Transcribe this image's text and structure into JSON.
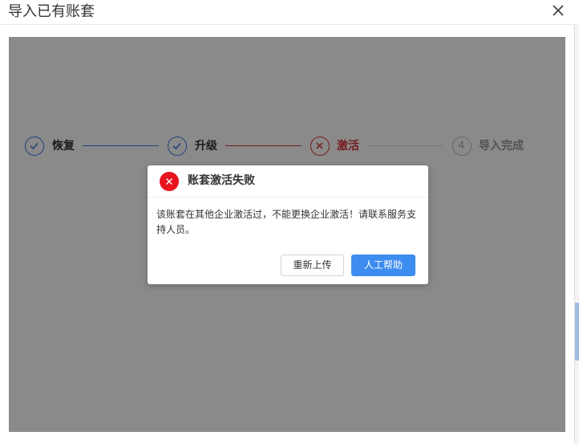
{
  "window": {
    "title": "导入已有账套",
    "close_icon": "close-icon"
  },
  "steps": [
    {
      "label": "恢复",
      "status": "done",
      "icon": "check-icon"
    },
    {
      "label": "升级",
      "status": "done",
      "icon": "check-icon"
    },
    {
      "label": "激活",
      "status": "failed",
      "icon": "close-icon"
    },
    {
      "label": "导入完成",
      "status": "pending",
      "number": "4"
    }
  ],
  "dialog": {
    "icon": "error-circle-icon",
    "title": "账套激活失败",
    "message": "该账套在其他企业激活过，不能更换企业激活！请联系服务支持人员。",
    "buttons": {
      "reupload": "重新上传",
      "help": "人工帮助"
    }
  },
  "colors": {
    "primary": "#3d8cf0",
    "step_done": "#3d7ae6",
    "step_failed": "#d9333a",
    "step_pending": "#bfbfbf",
    "error": "#e8141e",
    "overlay": "rgba(0,0,0,0.46)"
  }
}
